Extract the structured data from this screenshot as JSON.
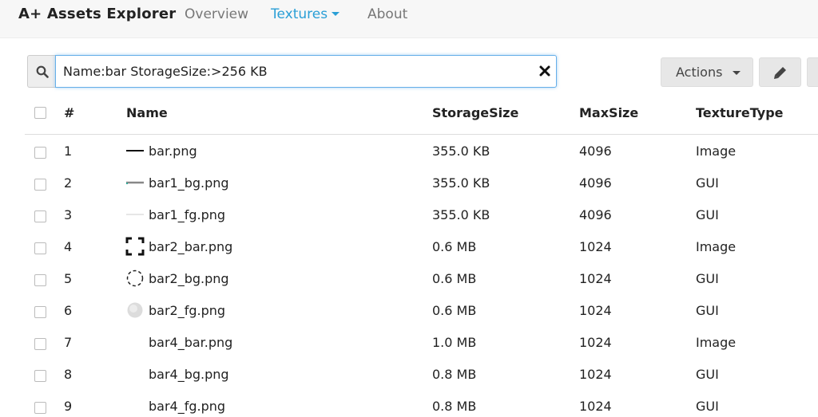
{
  "navbar": {
    "brand": "A+ Assets Explorer",
    "links": [
      {
        "label": "Overview"
      },
      {
        "label": "Textures"
      },
      {
        "label": "About"
      }
    ]
  },
  "search": {
    "value": "Name:bar StorageSize:>256 KB "
  },
  "toolbar": {
    "actions_label": "Actions"
  },
  "table": {
    "columns": [
      "#",
      "Name",
      "StorageSize",
      "MaxSize",
      "TextureType"
    ],
    "rows": [
      {
        "num": "1",
        "name": "bar.png",
        "storage": "355.0 KB",
        "maxsize": "4096",
        "type": "Image",
        "thumb": "black-line"
      },
      {
        "num": "2",
        "name": "bar1_bg.png",
        "storage": "355.0 KB",
        "maxsize": "4096",
        "type": "GUI",
        "thumb": "gray-line"
      },
      {
        "num": "3",
        "name": "bar1_fg.png",
        "storage": "355.0 KB",
        "maxsize": "4096",
        "type": "GUI",
        "thumb": "faint-line"
      },
      {
        "num": "4",
        "name": "bar2_bar.png",
        "storage": "0.6 MB",
        "maxsize": "1024",
        "type": "Image",
        "thumb": "corner-frame"
      },
      {
        "num": "5",
        "name": "bar2_bg.png",
        "storage": "0.6 MB",
        "maxsize": "1024",
        "type": "GUI",
        "thumb": "dashed-circle"
      },
      {
        "num": "6",
        "name": "bar2_fg.png",
        "storage": "0.6 MB",
        "maxsize": "1024",
        "type": "GUI",
        "thumb": "gray-blob"
      },
      {
        "num": "7",
        "name": "bar4_bar.png",
        "storage": "1.0 MB",
        "maxsize": "1024",
        "type": "Image",
        "thumb": "none"
      },
      {
        "num": "8",
        "name": "bar4_bg.png",
        "storage": "0.8 MB",
        "maxsize": "1024",
        "type": "GUI",
        "thumb": "none"
      },
      {
        "num": "9",
        "name": "bar4_fg.png",
        "storage": "0.8 MB",
        "maxsize": "1024",
        "type": "GUI",
        "thumb": "none"
      }
    ]
  }
}
